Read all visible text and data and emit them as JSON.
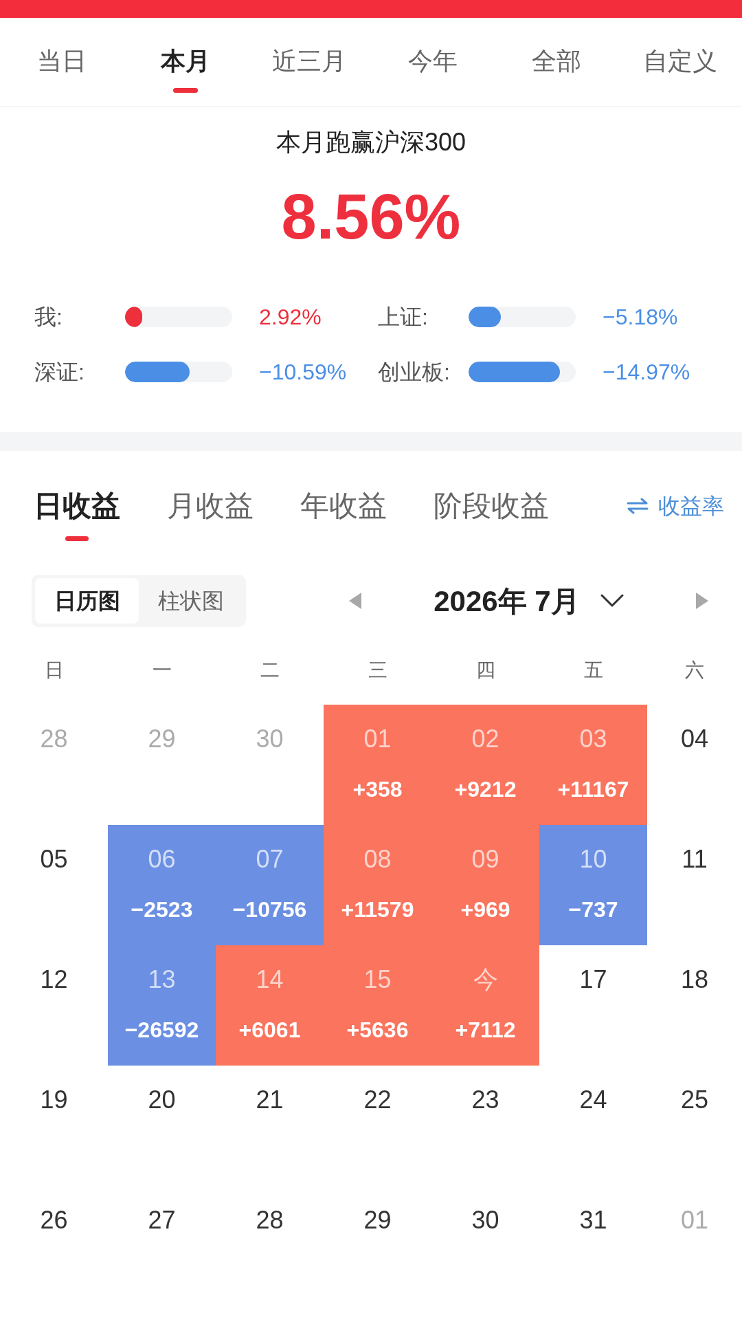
{
  "period_tabs": [
    {
      "label": "当日",
      "selected": false
    },
    {
      "label": "本月",
      "selected": true
    },
    {
      "label": "近三月",
      "selected": false
    },
    {
      "label": "今年",
      "selected": false
    },
    {
      "label": "全部",
      "selected": false
    },
    {
      "label": "自定义",
      "selected": false
    }
  ],
  "summary": {
    "title": "本月跑赢沪深300",
    "value": "8.56%"
  },
  "comparisons": [
    {
      "label": "我:",
      "level": 0.16,
      "value": "2.92%",
      "color": "#ee2f3c"
    },
    {
      "label": "上证:",
      "level": 0.3,
      "value": "−5.18%",
      "color": "#4a8ee6"
    },
    {
      "label": "深证:",
      "level": 0.6,
      "value": "−10.59%",
      "color": "#4a8ee6"
    },
    {
      "label": "创业板:",
      "level": 0.85,
      "value": "−14.97%",
      "color": "#4a8ee6"
    }
  ],
  "profit_tabs": [
    {
      "label": "日收益",
      "selected": true
    },
    {
      "label": "月收益",
      "selected": false
    },
    {
      "label": "年收益",
      "selected": false
    },
    {
      "label": "阶段收益",
      "selected": false
    }
  ],
  "rate_toggle": {
    "label": "收益率"
  },
  "view_toggle": [
    {
      "label": "日历图",
      "selected": true
    },
    {
      "label": "柱状图",
      "selected": false
    }
  ],
  "month_picker": {
    "label": "2026年 7月"
  },
  "calendar": {
    "weekdays": [
      "日",
      "一",
      "二",
      "三",
      "四",
      "五",
      "六"
    ],
    "weeks": [
      [
        {
          "day": "28",
          "kind": "outside"
        },
        {
          "day": "29",
          "kind": "outside"
        },
        {
          "day": "30",
          "kind": "outside"
        },
        {
          "day": "01",
          "kind": "gain",
          "value": "+358"
        },
        {
          "day": "02",
          "kind": "gain",
          "value": "+9212"
        },
        {
          "day": "03",
          "kind": "gain",
          "value": "+11167"
        },
        {
          "day": "04",
          "kind": "plain"
        }
      ],
      [
        {
          "day": "05",
          "kind": "plain"
        },
        {
          "day": "06",
          "kind": "loss",
          "value": "−2523"
        },
        {
          "day": "07",
          "kind": "loss",
          "value": "−10756"
        },
        {
          "day": "08",
          "kind": "gain",
          "value": "+11579"
        },
        {
          "day": "09",
          "kind": "gain",
          "value": "+969"
        },
        {
          "day": "10",
          "kind": "loss",
          "value": "−737"
        },
        {
          "day": "11",
          "kind": "plain"
        }
      ],
      [
        {
          "day": "12",
          "kind": "plain"
        },
        {
          "day": "13",
          "kind": "loss",
          "value": "−26592"
        },
        {
          "day": "14",
          "kind": "gain",
          "value": "+6061"
        },
        {
          "day": "15",
          "kind": "gain",
          "value": "+5636"
        },
        {
          "day": "今",
          "kind": "gain",
          "value": "+7112"
        },
        {
          "day": "17",
          "kind": "plain"
        },
        {
          "day": "18",
          "kind": "plain"
        }
      ],
      [
        {
          "day": "19",
          "kind": "plain"
        },
        {
          "day": "20",
          "kind": "plain"
        },
        {
          "day": "21",
          "kind": "plain"
        },
        {
          "day": "22",
          "kind": "plain"
        },
        {
          "day": "23",
          "kind": "plain"
        },
        {
          "day": "24",
          "kind": "plain"
        },
        {
          "day": "25",
          "kind": "plain"
        }
      ],
      [
        {
          "day": "26",
          "kind": "plain"
        },
        {
          "day": "27",
          "kind": "plain"
        },
        {
          "day": "28",
          "kind": "plain"
        },
        {
          "day": "29",
          "kind": "plain"
        },
        {
          "day": "30",
          "kind": "plain"
        },
        {
          "day": "31",
          "kind": "plain"
        },
        {
          "day": "01",
          "kind": "outside"
        }
      ]
    ]
  }
}
